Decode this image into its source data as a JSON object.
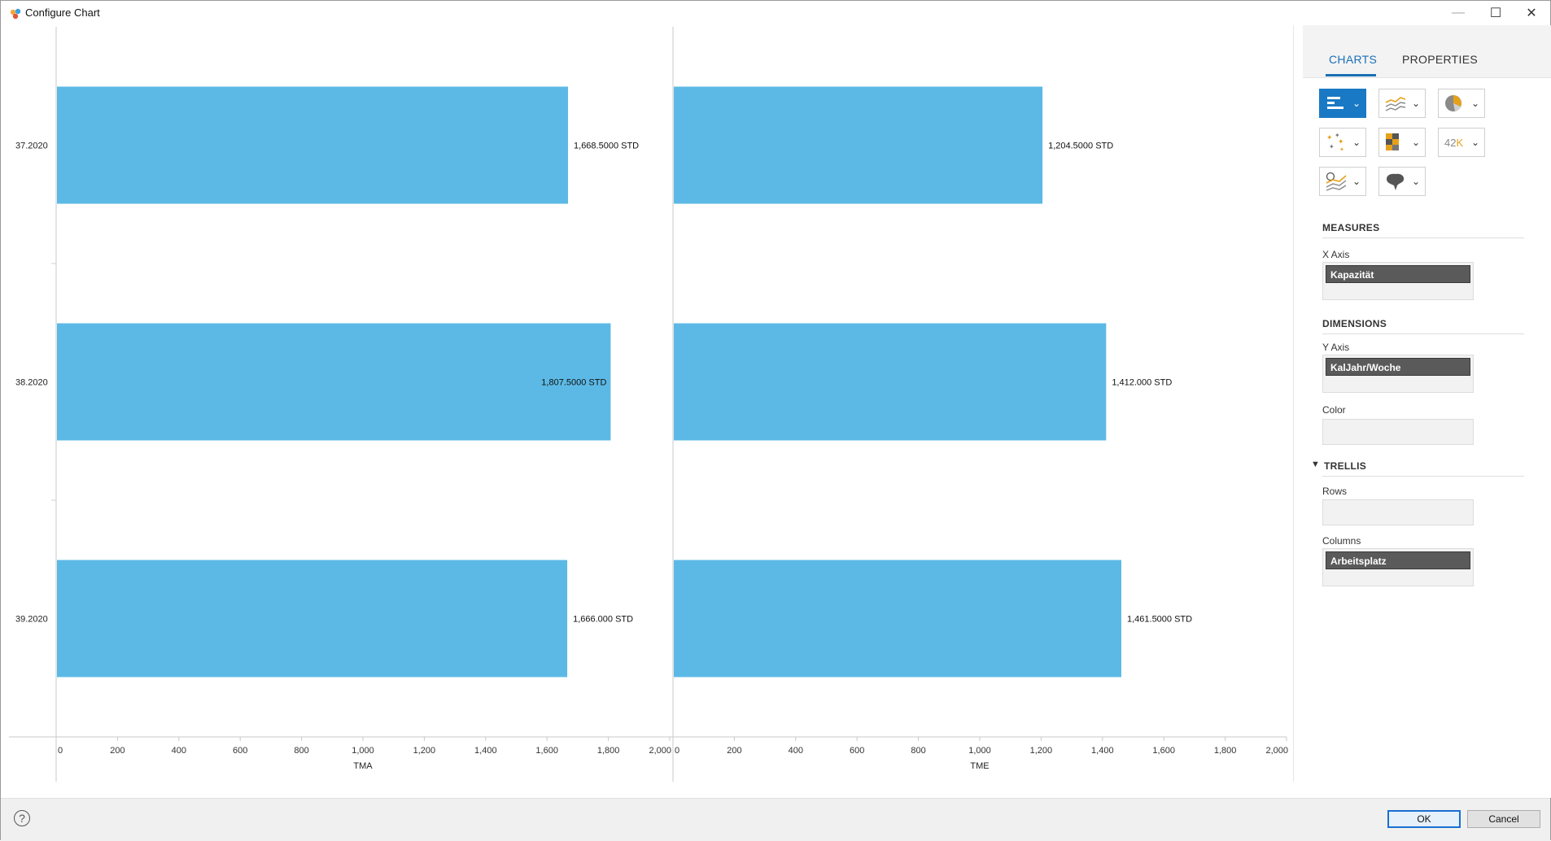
{
  "window": {
    "title": "Configure Chart",
    "minimize_glyph": "—",
    "maximize_glyph": "☐",
    "close_glyph": "✕"
  },
  "chart_data": {
    "type": "bar",
    "orientation": "horizontal",
    "categories": [
      "37.2020",
      "38.2020",
      "39.2020"
    ],
    "xlim": [
      0,
      2000
    ],
    "ticks": [
      "0",
      "200",
      "400",
      "600",
      "800",
      "1,000",
      "1,200",
      "1,400",
      "1,600",
      "1,800",
      "2,000"
    ],
    "bar_color": "#5cb9e5",
    "panels": [
      {
        "xlabel": "TMA",
        "values": [
          1668.5,
          1807.5,
          1666.0
        ],
        "value_labels": [
          "1,668.5000 STD",
          "1,807.5000 STD",
          "1,666.000 STD"
        ]
      },
      {
        "xlabel": "TME",
        "values": [
          1204.5,
          1412.0,
          1461.5
        ],
        "value_labels": [
          "1,204.5000 STD",
          "1,412.000 STD",
          "1,461.5000 STD"
        ]
      }
    ]
  },
  "panel": {
    "tabs": {
      "charts": "CHARTS",
      "properties": "PROPERTIES"
    },
    "chart_types": [
      {
        "name": "bar-chart-icon",
        "selected": true
      },
      {
        "name": "line-chart-icon",
        "selected": false
      },
      {
        "name": "pie-chart-icon",
        "selected": false
      },
      {
        "name": "scatter-chart-icon",
        "selected": false
      },
      {
        "name": "heatmap-chart-icon",
        "selected": false
      },
      {
        "name": "kpi-number-icon",
        "selected": false,
        "text": "42K"
      },
      {
        "name": "forecast-chart-icon",
        "selected": false
      },
      {
        "name": "geo-map-icon",
        "selected": false
      }
    ],
    "measures": {
      "title": "MEASURES",
      "x_axis_label": "X Axis",
      "x_axis_value": "Kapazität"
    },
    "dimensions": {
      "title": "DIMENSIONS",
      "y_axis_label": "Y Axis",
      "y_axis_value": "KalJahr/Woche",
      "color_label": "Color"
    },
    "trellis": {
      "title": "TRELLIS",
      "rows_label": "Rows",
      "columns_label": "Columns",
      "columns_value": "Arbeitsplatz"
    }
  },
  "footer": {
    "help": "?",
    "ok": "OK",
    "cancel": "Cancel"
  },
  "colors": {
    "accent": "#1a79c4",
    "pill": "#5a5a5a",
    "bar": "#5cb9e5"
  }
}
